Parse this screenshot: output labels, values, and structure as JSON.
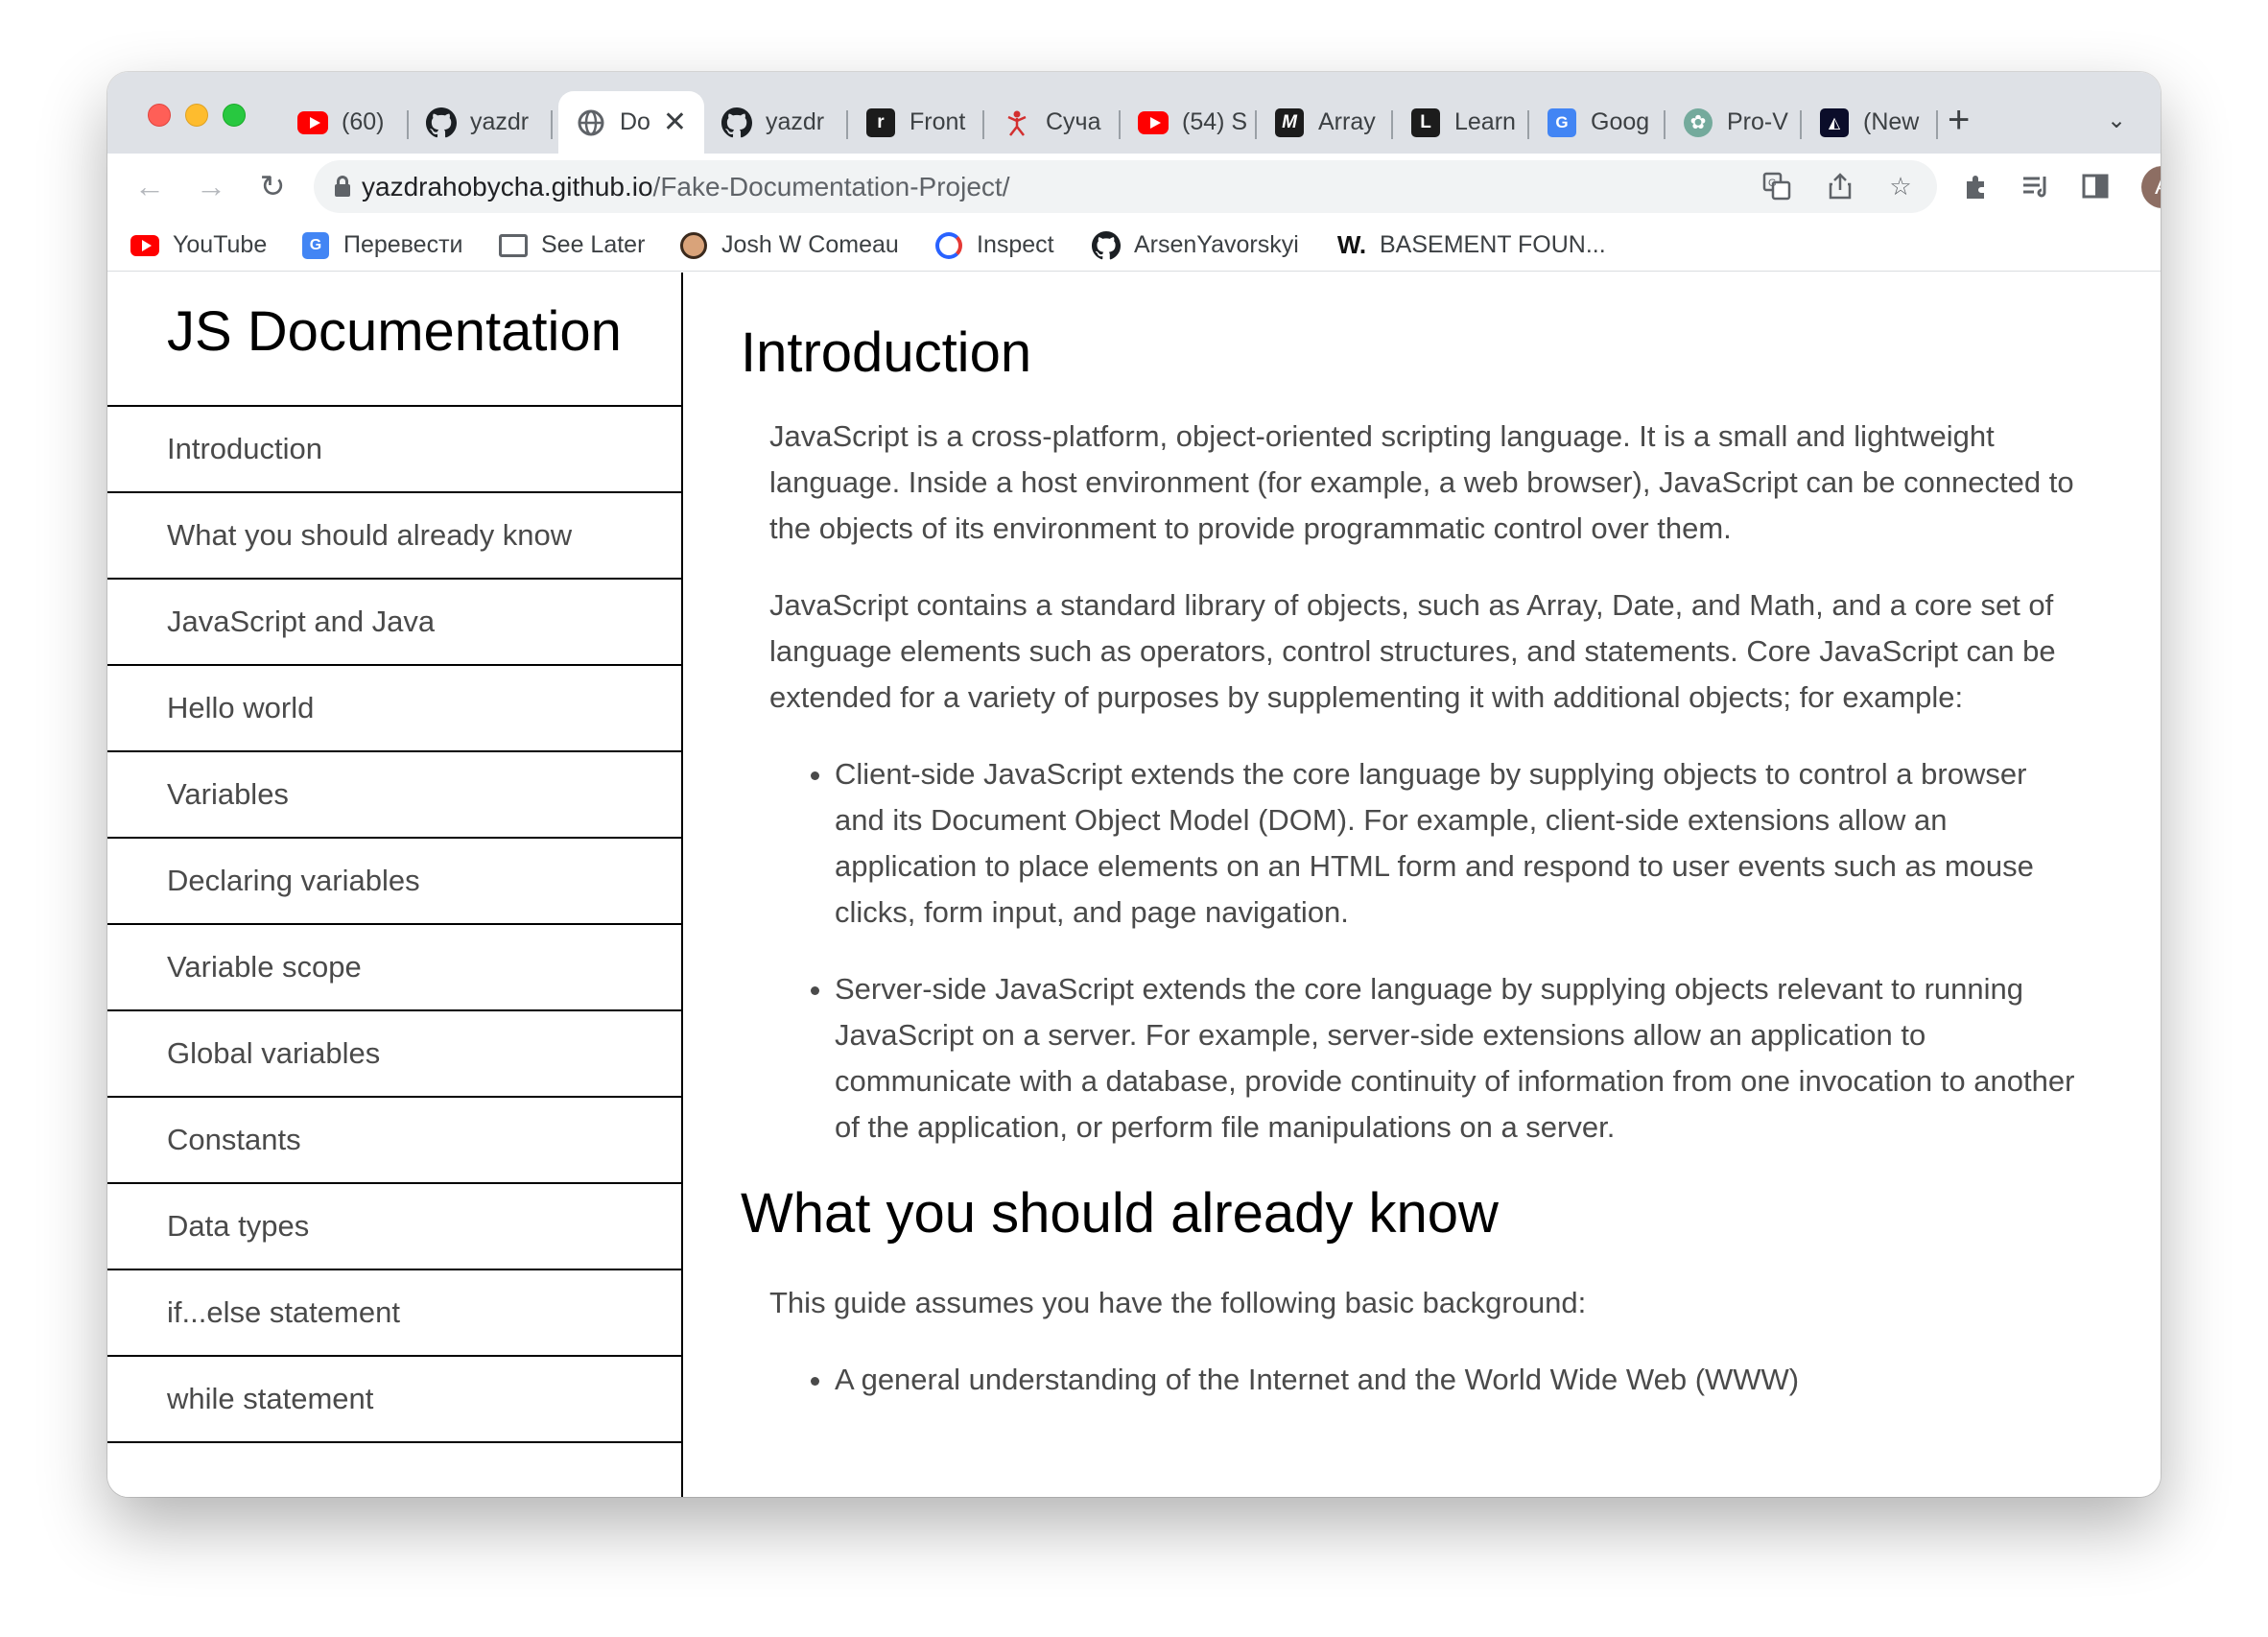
{
  "browser": {
    "tabs": [
      {
        "title": "(60)",
        "favicon": "youtube-icon"
      },
      {
        "title": "yazdr",
        "favicon": "github-icon"
      },
      {
        "title": "Do",
        "favicon": "globe-icon",
        "active": true
      },
      {
        "title": "yazdr",
        "favicon": "github-icon"
      },
      {
        "title": "Front",
        "favicon": "frontend-mentor-icon"
      },
      {
        "title": "Суча",
        "favicon": "red-figure-icon"
      },
      {
        "title": "(54) S",
        "favicon": "youtube-icon"
      },
      {
        "title": "Array",
        "favicon": "mdn-icon"
      },
      {
        "title": "Learn",
        "favicon": "learn-icon"
      },
      {
        "title": "Goog",
        "favicon": "google-translate-icon"
      },
      {
        "title": "Pro-V",
        "favicon": "chatgpt-icon"
      },
      {
        "title": "(New",
        "favicon": "dev-icon"
      }
    ],
    "url_host": "yazdrahobycha.github.io",
    "url_path": "/Fake-Documentation-Project/",
    "profile_initial": "A",
    "bookmarks": [
      {
        "label": "YouTube",
        "icon": "youtube-icon"
      },
      {
        "label": "Перевести",
        "icon": "google-translate-icon"
      },
      {
        "label": "See Later",
        "icon": "folder-icon"
      },
      {
        "label": "Josh W Comeau",
        "icon": "avatar-icon"
      },
      {
        "label": "Inspect",
        "icon": "inspect-icon"
      },
      {
        "label": "ArsenYavorskyi",
        "icon": "github-icon"
      },
      {
        "label": "BASEMENT FOUN...",
        "icon": "w-logo-icon"
      }
    ]
  },
  "page": {
    "title": "JS Documentation",
    "nav_links": [
      "Introduction",
      "What you should already know",
      "JavaScript and Java",
      "Hello world",
      "Variables",
      "Declaring variables",
      "Variable scope",
      "Global variables",
      "Constants",
      "Data types",
      "if...else statement",
      "while statement"
    ],
    "sections": [
      {
        "heading": "Introduction",
        "paragraphs": [
          "JavaScript is a cross-platform, object-oriented scripting language. It is a small and lightweight language. Inside a host environment (for example, a web browser), JavaScript can be connected to the objects of its environment to provide programmatic control over them.",
          "JavaScript contains a standard library of objects, such as Array, Date, and Math, and a core set of language elements such as operators, control structures, and statements. Core JavaScript can be extended for a variety of purposes by supplementing it with additional objects; for example:"
        ],
        "list": [
          "Client-side JavaScript extends the core language by supplying objects to control a browser and its Document Object Model (DOM). For example, client-side extensions allow an application to place elements on an HTML form and respond to user events such as mouse clicks, form input, and page navigation.",
          "Server-side JavaScript extends the core language by supplying objects relevant to running JavaScript on a server. For example, server-side extensions allow an application to communicate with a database, provide continuity of information from one invocation to another of the application, or perform file manipulations on a server."
        ]
      },
      {
        "heading": "What you should already know",
        "paragraphs": [
          "This guide assumes you have the following basic background:"
        ],
        "list": [
          "A general understanding of the Internet and the World Wide Web (WWW)"
        ]
      }
    ]
  }
}
